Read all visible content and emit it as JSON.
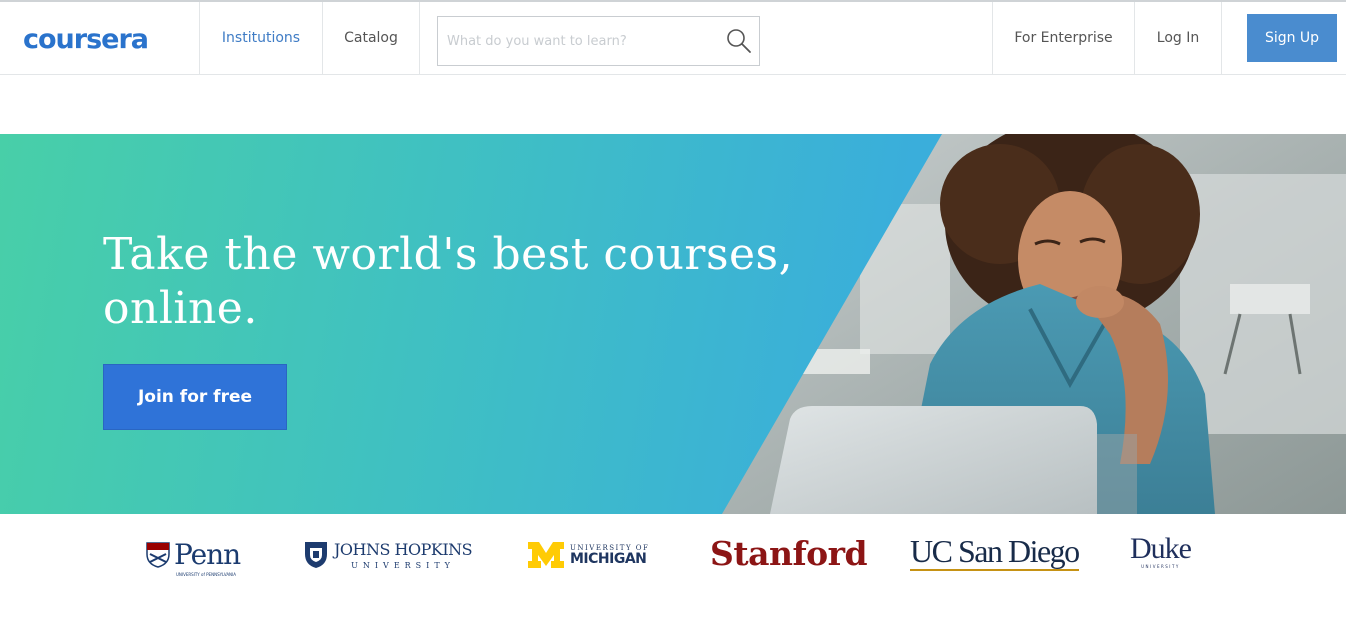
{
  "header": {
    "logo_text": "coursera",
    "nav": {
      "institutions": "Institutions",
      "catalog": "Catalog",
      "enterprise": "For Enterprise",
      "login": "Log In",
      "signup": "Sign Up"
    },
    "search": {
      "placeholder": "What do you want to learn?",
      "icon": "search-icon"
    }
  },
  "hero": {
    "title_line1": "Take the world's best courses,",
    "title_line2": "online.",
    "cta_label": "Join for free",
    "colors": {
      "gradient_start": "#48cfa8",
      "gradient_end": "#38a6dd",
      "cta": "#2f73d8"
    }
  },
  "partners": {
    "penn": {
      "name": "Penn",
      "sub": "UNIVERSITY of PENNSYLVANIA"
    },
    "jhu": {
      "name": "JOHNS HOPKINS",
      "sub": "UNIVERSITY"
    },
    "umich": {
      "small": "UNIVERSITY OF",
      "big": "MICHIGAN"
    },
    "stanford": {
      "name": "Stanford"
    },
    "ucsd": {
      "name": "UC San Diego"
    },
    "duke": {
      "name": "Duke",
      "sub": "UNIVERSITY"
    }
  },
  "colors": {
    "brand": "#2a73cc",
    "signup_bg": "#4a8ccf",
    "stanford": "#8c1515",
    "ucsd_gold": "#c69214"
  }
}
